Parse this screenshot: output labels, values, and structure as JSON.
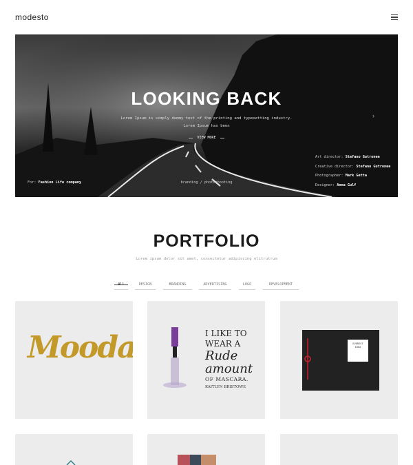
{
  "header": {
    "logo": "modesto",
    "menu_icon": "hamburger-menu-icon"
  },
  "hero": {
    "title": "LOOKING BACK",
    "subtitle_line1": "Lorem Ipsum is simply dummy text of the printing and typesetting industry.",
    "subtitle_line2": "Lorem Ipsum has been",
    "view_more": "VIEW MORE",
    "arrow": "›",
    "for_label": "For:",
    "for_value": "Fashion Life company",
    "tags": "branding / photoshooting",
    "credits": [
      {
        "label": "Art director:",
        "value": "Stefano Gutronee"
      },
      {
        "label": "Creative director:",
        "value": "Stefano Gutronee"
      },
      {
        "label": "Photographer:",
        "value": "Mark Getta"
      },
      {
        "label": "Designer:",
        "value": "Anna Gulf"
      }
    ]
  },
  "portfolio": {
    "title": "PORTFOLIO",
    "subtitle": "Lorem ipsum dolor sit amet, consectetur adipiscing elitrutrum",
    "filters": [
      "All",
      "DESIGN",
      "BRANDING",
      "ADVERTISING",
      "LOGO",
      "DEVELOPMENT"
    ],
    "active_filter": "All",
    "tiles": {
      "mooda": "Mooda",
      "mascara_lines": [
        "I LIKE TO",
        "WEAR A",
        "Rude",
        "amount",
        "OF MASCARA."
      ],
      "mascara_sign": "KAITLYN BRISTOWE",
      "mascara_sign2": "Bristowe",
      "card_line1": "EVEREST",
      "card_line2": "IDEA"
    }
  },
  "colors": {
    "background": "#ffffff",
    "tile": "#ececec",
    "gold": "#c39a2a",
    "hero_bg": "#1a1a1a"
  }
}
